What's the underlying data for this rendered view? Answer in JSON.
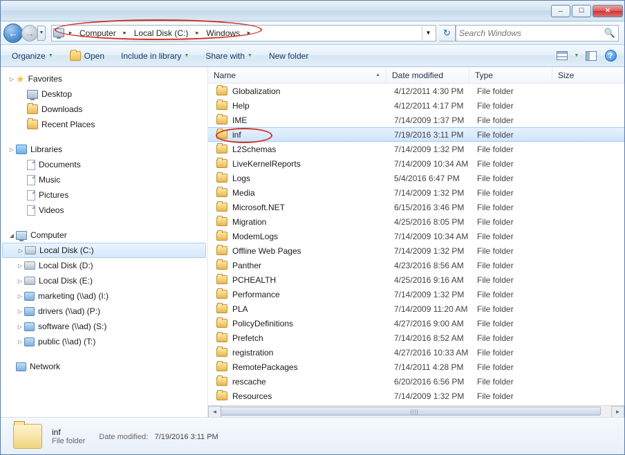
{
  "breadcrumb": {
    "items": [
      "Computer",
      "Local Disk (C:)",
      "Windows"
    ]
  },
  "search": {
    "placeholder": "Search Windows"
  },
  "toolbar": {
    "organize": "Organize",
    "open": "Open",
    "include": "Include in library",
    "share": "Share with",
    "newfolder": "New folder"
  },
  "sidebar": {
    "favorites": {
      "label": "Favorites",
      "items": [
        "Desktop",
        "Downloads",
        "Recent Places"
      ]
    },
    "libraries": {
      "label": "Libraries",
      "items": [
        "Documents",
        "Music",
        "Pictures",
        "Videos"
      ]
    },
    "computer": {
      "label": "Computer",
      "items": [
        "Local Disk (C:)",
        "Local Disk (D:)",
        "Local Disk (E:)",
        "marketing (\\\\ad) (I:)",
        "drivers (\\\\ad) (P:)",
        "software (\\\\ad) (S:)",
        "public (\\\\ad) (T:)"
      ]
    },
    "network": {
      "label": "Network"
    }
  },
  "columns": {
    "name": "Name",
    "date": "Date modified",
    "type": "Type",
    "size": "Size"
  },
  "folder_type": "File folder",
  "files": [
    {
      "name": "Globalization",
      "date": "4/12/2011 4:30 PM"
    },
    {
      "name": "Help",
      "date": "4/12/2011 4:17 PM"
    },
    {
      "name": "IME",
      "date": "7/14/2009 1:37 PM"
    },
    {
      "name": "inf",
      "date": "7/19/2016 3:11 PM",
      "selected": true
    },
    {
      "name": "L2Schemas",
      "date": "7/14/2009 1:32 PM"
    },
    {
      "name": "LiveKernelReports",
      "date": "7/14/2009 10:34 AM"
    },
    {
      "name": "Logs",
      "date": "5/4/2016 6:47 PM"
    },
    {
      "name": "Media",
      "date": "7/14/2009 1:32 PM"
    },
    {
      "name": "Microsoft.NET",
      "date": "6/15/2016 3:46 PM"
    },
    {
      "name": "Migration",
      "date": "4/25/2016 8:05 PM"
    },
    {
      "name": "ModemLogs",
      "date": "7/14/2009 10:34 AM"
    },
    {
      "name": "Offline Web Pages",
      "date": "7/14/2009 1:32 PM"
    },
    {
      "name": "Panther",
      "date": "4/23/2016 8:56 AM"
    },
    {
      "name": "PCHEALTH",
      "date": "4/25/2016 9:16 AM"
    },
    {
      "name": "Performance",
      "date": "7/14/2009 1:32 PM"
    },
    {
      "name": "PLA",
      "date": "7/14/2009 11:20 AM"
    },
    {
      "name": "PolicyDefinitions",
      "date": "4/27/2016 9:00 AM"
    },
    {
      "name": "Prefetch",
      "date": "7/14/2016 8:52 AM"
    },
    {
      "name": "registration",
      "date": "4/27/2016 10:33 AM"
    },
    {
      "name": "RemotePackages",
      "date": "7/14/2011 4:28 PM"
    },
    {
      "name": "rescache",
      "date": "6/20/2016 6:56 PM"
    },
    {
      "name": "Resources",
      "date": "7/14/2009 1:32 PM"
    }
  ],
  "details": {
    "name": "inf",
    "type": "File folder",
    "date_label": "Date modified:",
    "date_value": "7/19/2016 3:11 PM"
  }
}
